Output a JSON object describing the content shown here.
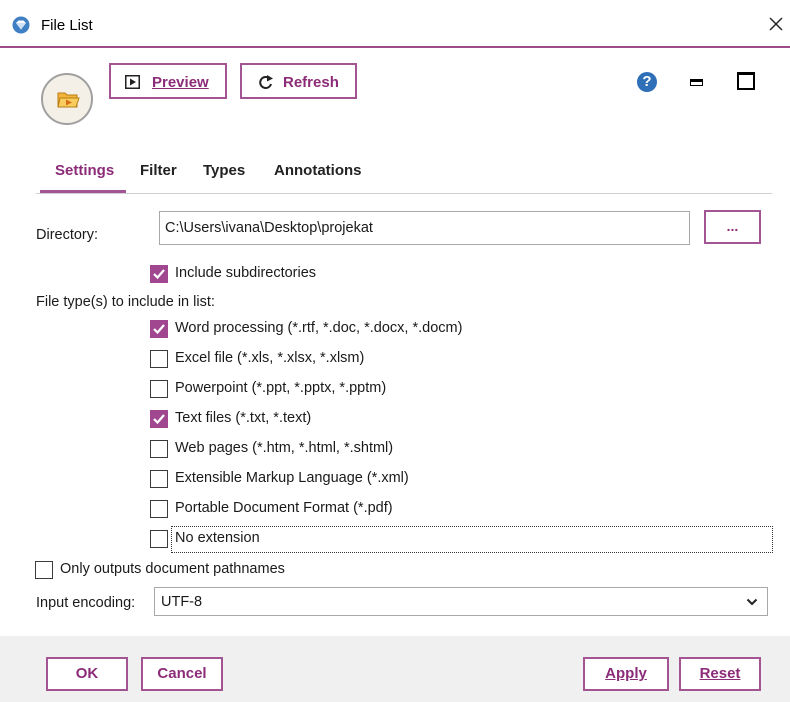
{
  "window": {
    "title": "File List",
    "close_icon": "close-icon"
  },
  "toolbar": {
    "preview_label": "Preview",
    "refresh_label": "Refresh",
    "help_glyph": "?"
  },
  "tabs": [
    {
      "label": "Settings",
      "active": true
    },
    {
      "label": "Filter",
      "active": false
    },
    {
      "label": "Types",
      "active": false
    },
    {
      "label": "Annotations",
      "active": false
    }
  ],
  "settings": {
    "directory_label": "Directory:",
    "directory_value": "C:\\Users\\ivana\\Desktop\\projekat",
    "browse_label": "...",
    "include_subdirectories": {
      "label": "Include subdirectories",
      "checked": true
    },
    "file_types_label": "File type(s) to include in list:",
    "file_types": [
      {
        "label": "Word processing (*.rtf, *.doc, *.docx, *.docm)",
        "checked": true
      },
      {
        "label": "Excel file (*.xls, *.xlsx, *.xlsm)",
        "checked": false
      },
      {
        "label": "Powerpoint (*.ppt, *.pptx, *.pptm)",
        "checked": false
      },
      {
        "label": "Text files (*.txt, *.text)",
        "checked": true
      },
      {
        "label": "Web pages (*.htm, *.html, *.shtml)",
        "checked": false
      },
      {
        "label": "Extensible Markup Language (*.xml)",
        "checked": false
      },
      {
        "label": "Portable Document Format (*.pdf)",
        "checked": false
      },
      {
        "label": "No extension",
        "checked": false
      }
    ],
    "only_pathnames": {
      "label": "Only outputs document pathnames",
      "checked": false
    },
    "encoding_label": "Input encoding:",
    "encoding_value": "UTF-8"
  },
  "footer": {
    "ok_label": "OK",
    "cancel_label": "Cancel",
    "apply_label": "Apply",
    "reset_label": "Reset"
  },
  "colors": {
    "accent": "#a25592",
    "accent_text": "#8c2c78",
    "checkbox_fill": "#a0478f",
    "help_blue": "#2e6fb8"
  }
}
